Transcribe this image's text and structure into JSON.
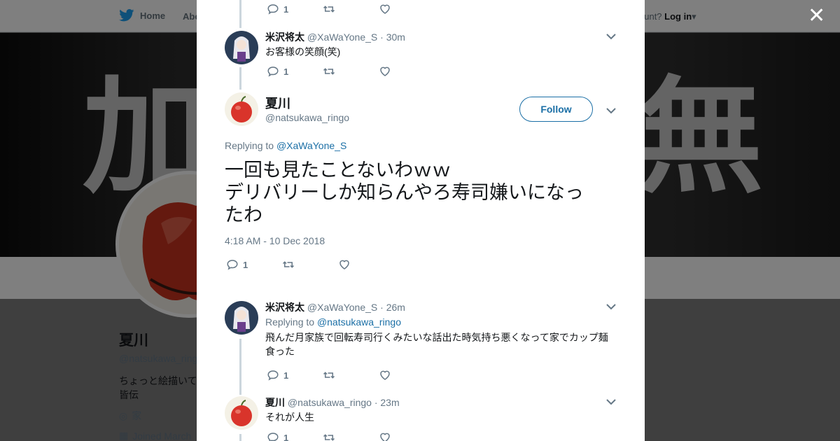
{
  "nav": {
    "home": "Home",
    "about": "Abo",
    "account": "ccount?",
    "login": "Log in"
  },
  "banner": {
    "left_char": "加",
    "right_char": "無"
  },
  "profile": {
    "name": "夏川",
    "handle": "@natsukawa_ring",
    "bio_line1": "ちょっと絵描いて",
    "bio_line2": "皆伝",
    "location": "家",
    "joined": "Joined March"
  },
  "tweets": [
    {
      "name": "米沢将太",
      "handle": "@XaWaYone_S",
      "time": "· 30m",
      "text": "お客様の笑顔(笑)",
      "replies": "1"
    },
    {
      "name": "米沢将太",
      "handle": "@XaWaYone_S",
      "time": "· 26m",
      "reply_prefix": "Replying to",
      "reply_to": "@natsukawa_ringo",
      "text": "飛んだ月家族で回転寿司行くみたいな話出た時気持ち悪くなって家でカップ麺食った",
      "replies": "1"
    },
    {
      "name": "夏川",
      "handle": "@natsukawa_ringo",
      "time": "· 23m",
      "text": "それが人生",
      "replies": "1"
    }
  ],
  "top_actions": {
    "replies": "1"
  },
  "main_tweet": {
    "name": "夏川",
    "handle": "@natsukawa_ringo",
    "follow_label": "Follow",
    "reply_prefix": "Replying to",
    "reply_to": "@XaWaYone_S",
    "text_line1": "一回も見たことないわｗｗ",
    "text_line2": "デリバリーしか知らんやろ寿司嫌いになっ",
    "text_line3": "たわ",
    "timestamp": "4:18 AM - 10 Dec 2018",
    "replies": "1"
  },
  "colors": {
    "link": "#1b6fa6",
    "muted": "#657786",
    "line": "#ccd6dd",
    "apple": "#d9342b"
  }
}
